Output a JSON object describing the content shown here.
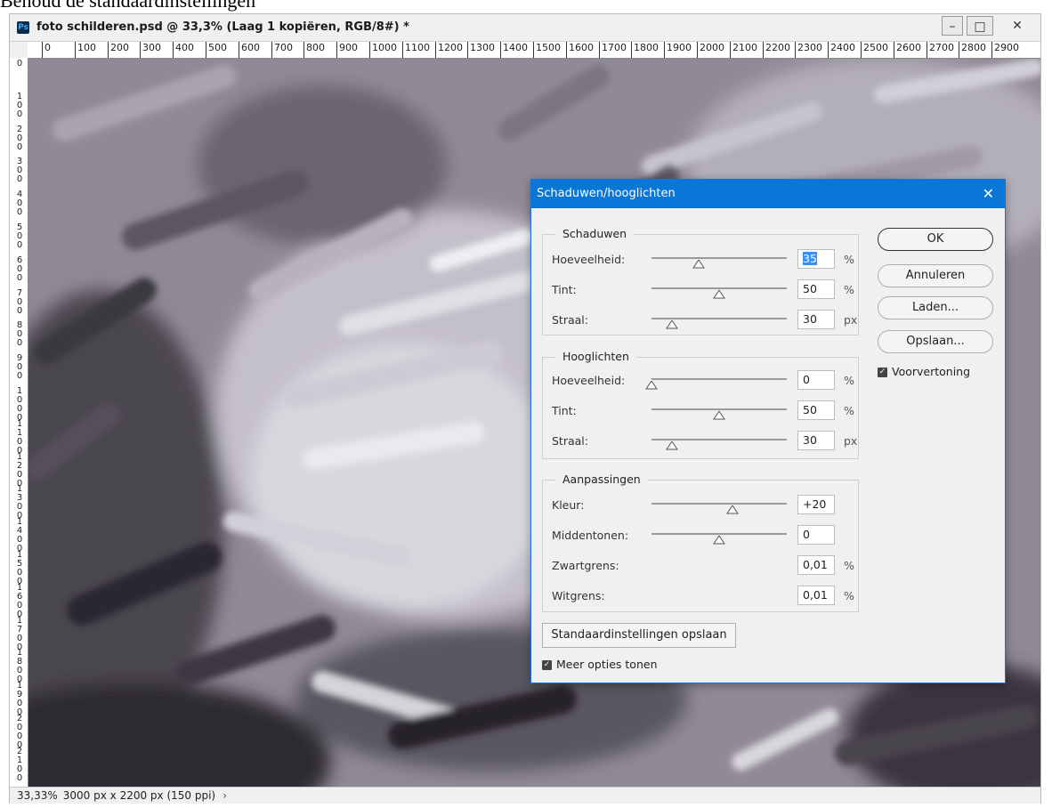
{
  "caption": "Behoud de standaardinstellingen",
  "window": {
    "title": "foto schilderen.psd @ 33,3% (Laag 1 kopiëren, RGB/8#) *",
    "app_icon": "photoshop-icon",
    "controls": {
      "minimize": "–",
      "maximize": "□",
      "close": "✕"
    }
  },
  "ruler": {
    "h_labels": [
      "0",
      "100",
      "200",
      "300",
      "400",
      "500",
      "600",
      "700",
      "800",
      "900",
      "1000",
      "1100",
      "1200",
      "1300",
      "1400",
      "1500",
      "1600",
      "1700",
      "1800",
      "1900",
      "2000",
      "2100",
      "2200",
      "2300",
      "2400",
      "2500",
      "2600",
      "2700",
      "2800",
      "2900"
    ],
    "v_labels": [
      "0",
      "100",
      "200",
      "300",
      "400",
      "500",
      "600",
      "700",
      "800",
      "900",
      "1000",
      "1100",
      "1200",
      "1300",
      "1400",
      "1500",
      "1600",
      "1700",
      "1800",
      "1900",
      "2000",
      "2100"
    ]
  },
  "status": {
    "zoom": "33,33%",
    "doc_info": "3000 px x 2200 px (150 ppi)",
    "arrow": "›"
  },
  "dialog": {
    "title": "Schaduwen/hooglichten",
    "close": "✕",
    "groups": [
      {
        "legend": "Schaduwen",
        "rows": [
          {
            "label": "Hoeveelheid:",
            "value": "35",
            "unit": "%",
            "position": 0.35,
            "selected": true
          },
          {
            "label": "Tint:",
            "value": "50",
            "unit": "%",
            "position": 0.5
          },
          {
            "label": "Straal:",
            "value": "30",
            "unit": "px",
            "position": 0.15
          }
        ]
      },
      {
        "legend": "Hooglichten",
        "rows": [
          {
            "label": "Hoeveelheid:",
            "value": "0",
            "unit": "%",
            "position": 0.0
          },
          {
            "label": "Tint:",
            "value": "50",
            "unit": "%",
            "position": 0.5
          },
          {
            "label": "Straal:",
            "value": "30",
            "unit": "px",
            "position": 0.15
          }
        ]
      },
      {
        "legend": "Aanpassingen",
        "rows": [
          {
            "label": "Kleur:",
            "value": "+20",
            "unit": "",
            "position": 0.6
          },
          {
            "label": "Middentonen:",
            "value": "0",
            "unit": "",
            "position": 0.5
          },
          {
            "label": "Zwartgrens:",
            "value": "0,01",
            "unit": "%",
            "position": null
          },
          {
            "label": "Witgrens:",
            "value": "0,01",
            "unit": "%",
            "position": null
          }
        ]
      }
    ],
    "buttons": {
      "ok": "OK",
      "cancel": "Annuleren",
      "load": "Laden...",
      "save": "Opslaan..."
    },
    "preview_label": "Voorvertoning",
    "preview_checked": true,
    "save_defaults_label": "Standaardinstellingen opslaan",
    "more_options_label": "Meer opties tonen",
    "more_options_checked": true
  }
}
